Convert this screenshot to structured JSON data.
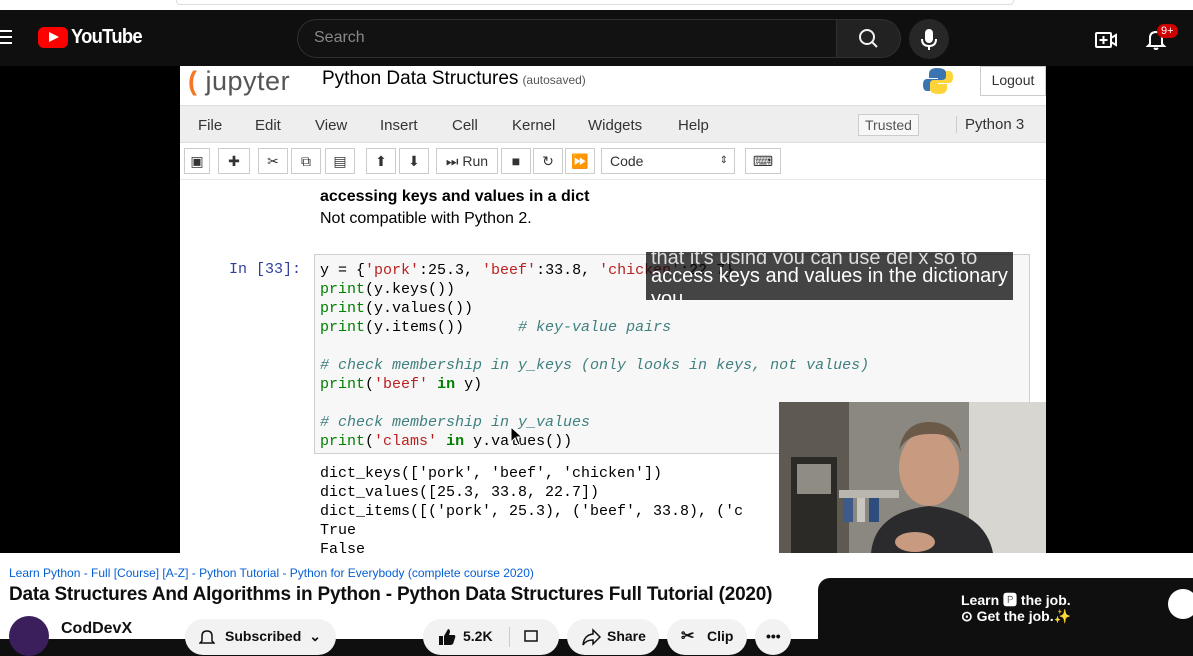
{
  "masthead": {
    "logo_text": "YouTube",
    "search_placeholder": "Search",
    "notif_count": "9+",
    "icons": [
      "menu-icon",
      "search-icon",
      "mic-icon",
      "create-icon",
      "bell-icon"
    ]
  },
  "video_frame": {
    "jupyter_brand": "jupyter",
    "notebook_title": "Python Data Structures",
    "autosaved": "(autosaved)",
    "logout": "Logout",
    "menu": [
      "File",
      "Edit",
      "View",
      "Insert",
      "Cell",
      "Kernel",
      "Widgets",
      "Help"
    ],
    "trusted": "Trusted",
    "kernel": "Python 3",
    "run_label": "Run",
    "cell_type": "Code",
    "markdown_heading": "accessing keys and values in a dict",
    "markdown_text": "Not compatible with Python 2.",
    "prompt": "In [33]:",
    "output_lines": [
      "dict_keys(['pork', 'beef', 'chicken'])",
      "dict_values([25.3, 33.8, 22.7])",
      "dict_items([('pork', 25.3), ('beef', 33.8), ('c",
      "True",
      "False"
    ],
    "caption_lines": [
      "that it's using you can use del x so to",
      "access keys and values in the dictionary",
      "you"
    ]
  },
  "details": {
    "playlist": "Learn Python - Full [Course] [A-Z] - Python Tutorial - Python for Everybody (complete course 2020)",
    "title": "Data Structures And Algorithms in Python - Python Data Structures Full Tutorial (2020)",
    "channel": "CodDevX",
    "subscribed": "Subscribed",
    "likes": "5.2K",
    "share": "Share",
    "clip": "Clip",
    "ad_line1": "Learn 🅿 the job.",
    "ad_line2": "⊙ Get the job.✨"
  },
  "colors": {
    "youtube_red": "#ff0000",
    "jupyter_orange": "#f37726",
    "link_blue": "#065fd4"
  }
}
